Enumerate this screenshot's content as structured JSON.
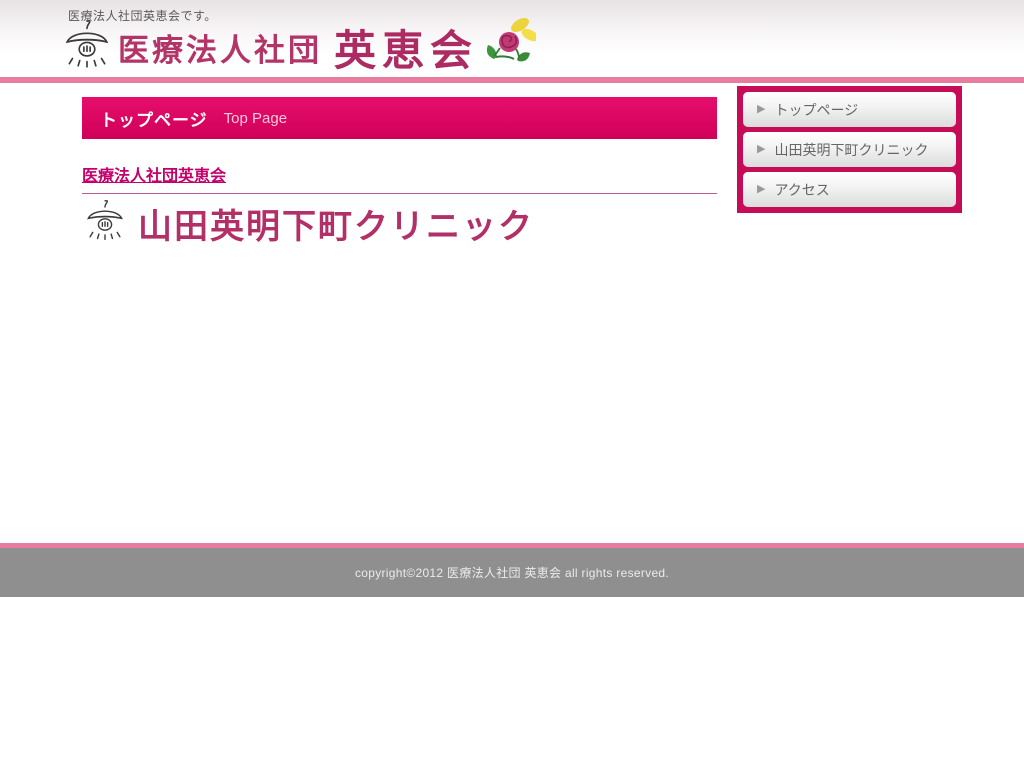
{
  "banner": {
    "tagline": "医療法人社団英恵会です。",
    "logo": {
      "org_prefix": "医療法人社団",
      "org_name": "英恵会",
      "lamp_icon": "pendant-lamp-icon",
      "flower_icon": "flower-icon"
    }
  },
  "main": {
    "page_header": {
      "title_ja": "トップページ",
      "title_en": "Top Page"
    },
    "org_link_label": "医療法人社団英恵会",
    "clinic_name": "山田英明下町クリニック"
  },
  "sidebar": {
    "arrow_icon": "▶",
    "items": [
      {
        "label": "トップページ"
      },
      {
        "label": "山田英明下町クリニック"
      },
      {
        "label": "アクセス"
      }
    ]
  },
  "footer": {
    "copyright": "copyright©2012 医療法人社団 英恵会 all rights reserved."
  },
  "colors": {
    "accent_dark": "#d00059",
    "accent_light": "#e87c9e",
    "sidebar_bg": "#c60c56",
    "logo_text": "#b23067",
    "link": "#c3006b",
    "footer_bg": "#8f8f8f"
  }
}
